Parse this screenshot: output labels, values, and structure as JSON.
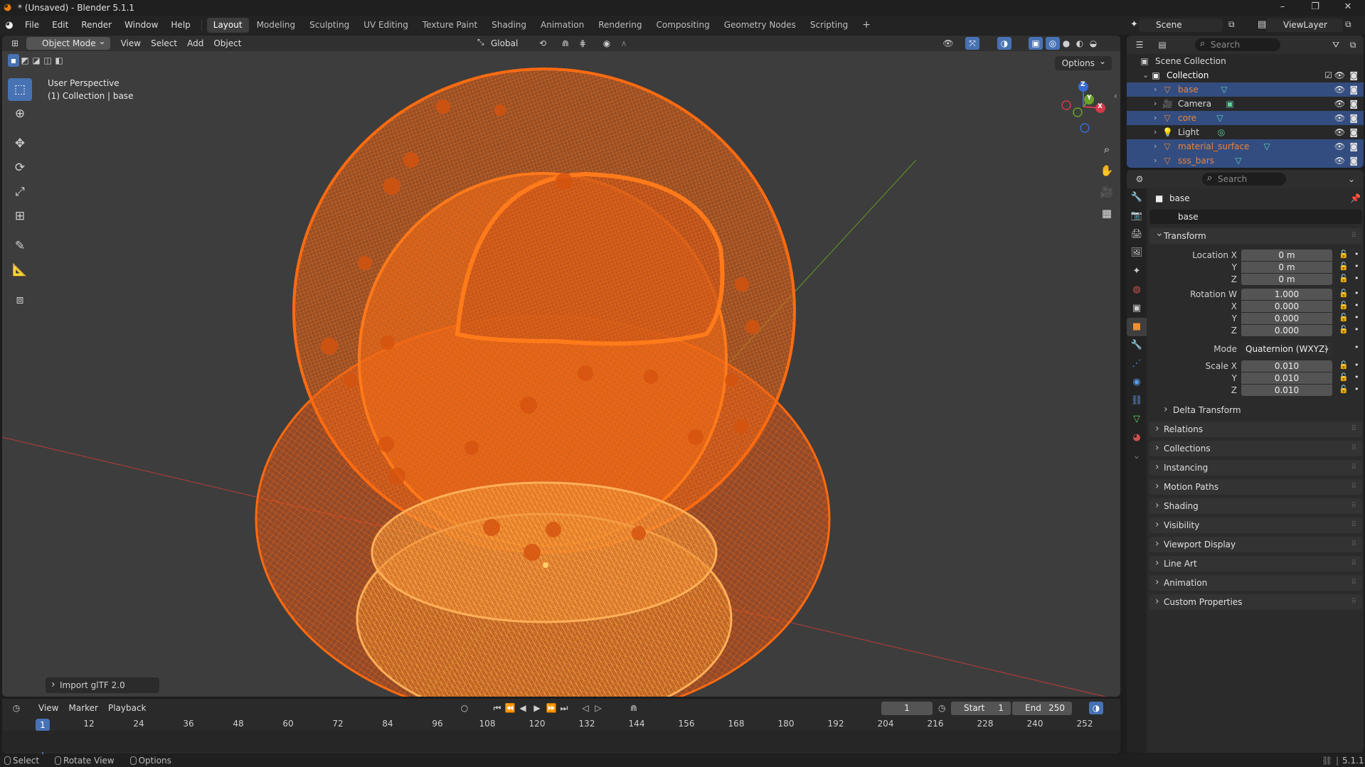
{
  "window": {
    "title": "* (Unsaved) - Blender 5.1.1",
    "controls": [
      "–",
      "❐",
      "✕"
    ]
  },
  "menu": [
    "File",
    "Edit",
    "Render",
    "Window",
    "Help"
  ],
  "workspaces": [
    "Layout",
    "Modeling",
    "Sculpting",
    "UV Editing",
    "Texture Paint",
    "Shading",
    "Animation",
    "Rendering",
    "Compositing",
    "Geometry Nodes",
    "Scripting"
  ],
  "active_workspace": "Layout",
  "scene": {
    "name": "Scene",
    "view_layer": "ViewLayer"
  },
  "viewport": {
    "mode": "Object Mode",
    "menus": [
      "View",
      "Select",
      "Add",
      "Object"
    ],
    "transform_orientation": "Global",
    "info_line1": "User Perspective",
    "info_line2": "(1) Collection | base",
    "options_label": "Options",
    "gizmo_axes": {
      "x": "X",
      "y": "Y",
      "z": "Z"
    },
    "last_operator": "Import glTF 2.0"
  },
  "timeline": {
    "menus": [
      "View",
      "Marker",
      "Playback"
    ],
    "current_frame": "1",
    "start_label": "Start",
    "start": "1",
    "end_label": "End",
    "end": "250",
    "ruler": [
      "12",
      "24",
      "36",
      "48",
      "60",
      "72",
      "84",
      "96",
      "108",
      "120",
      "132",
      "144",
      "156",
      "168",
      "180",
      "192",
      "204",
      "216",
      "228",
      "240",
      "252"
    ],
    "playhead_label": "1"
  },
  "status": {
    "items": [
      "Select",
      "Rotate View",
      "Options"
    ],
    "version": "5.1.1"
  },
  "outliner": {
    "search_placeholder": "Search",
    "root": "Scene Collection",
    "collection": "Collection",
    "items": [
      {
        "name": "base",
        "selected": true,
        "color": "#e8843c"
      },
      {
        "name": "Camera",
        "selected": false,
        "color": "#dcdcdc"
      },
      {
        "name": "core",
        "selected": true,
        "color": "#e8843c"
      },
      {
        "name": "Light",
        "selected": false,
        "color": "#dcdcdc"
      },
      {
        "name": "material_surface",
        "selected": true,
        "color": "#e8843c"
      },
      {
        "name": "sss_bars",
        "selected": true,
        "color": "#e8843c"
      }
    ]
  },
  "properties": {
    "search_placeholder": "Search",
    "object_name": "base",
    "object_field": "base",
    "transform": {
      "title": "Transform",
      "location": {
        "label_x": "Location X",
        "label_y": "Y",
        "label_z": "Z",
        "x": "0 m",
        "y": "0 m",
        "z": "0 m"
      },
      "rotation": {
        "label_w": "Rotation W",
        "label_x": "X",
        "label_y": "Y",
        "label_z": "Z",
        "w": "1.000",
        "x": "0.000",
        "y": "0.000",
        "z": "0.000"
      },
      "mode_label": "Mode",
      "mode": "Quaternion (WXYZ)",
      "scale": {
        "label_x": "Scale X",
        "label_y": "Y",
        "label_z": "Z",
        "x": "0.010",
        "y": "0.010",
        "z": "0.010"
      },
      "delta": "Delta Transform"
    },
    "panels": [
      "Relations",
      "Collections",
      "Instancing",
      "Motion Paths",
      "Shading",
      "Visibility",
      "Viewport Display",
      "Line Art",
      "Animation",
      "Custom Properties"
    ]
  },
  "colors": {
    "accent": "#4772b3",
    "wire": "#e8640c",
    "wire_selected": "#ffa64d"
  }
}
